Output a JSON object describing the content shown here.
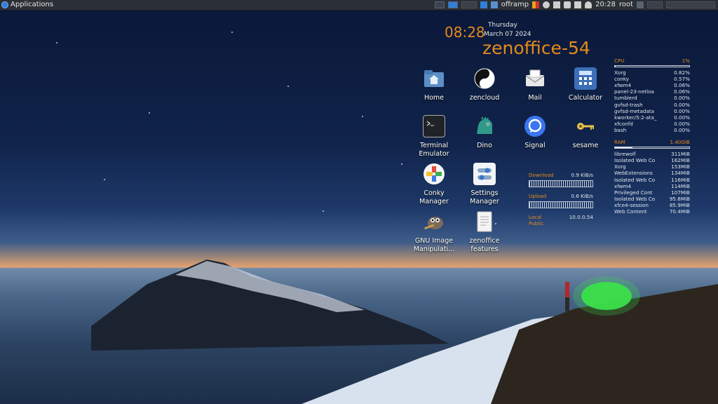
{
  "panel": {
    "apps_label": "Applications",
    "tray_app_label": "offramp",
    "time": "20:28",
    "user": "root"
  },
  "clock": {
    "time": "08:28",
    "day": "Thursday",
    "date": "March 07 2024",
    "hostname": "zenoffice-54"
  },
  "desktop_icons": [
    {
      "label": "Home",
      "icon": "folder-home-icon"
    },
    {
      "label": "zencloud",
      "icon": "yin-yang-icon"
    },
    {
      "label": "Mail",
      "icon": "mail-icon"
    },
    {
      "label": "Calculator",
      "icon": "calculator-icon"
    },
    {
      "label": "Terminal Emulator",
      "icon": "terminal-icon"
    },
    {
      "label": "Dino",
      "icon": "dino-icon"
    },
    {
      "label": "Signal",
      "icon": "signal-icon"
    },
    {
      "label": "sesame",
      "icon": "key-icon"
    },
    {
      "label": "Conky Manager",
      "icon": "conky-icon"
    },
    {
      "label": "Settings Manager",
      "icon": "settings-icon"
    },
    {
      "label": "GNU Image Manipulati...",
      "icon": "gimp-icon"
    },
    {
      "label": "zenoffice features",
      "icon": "document-icon"
    }
  ],
  "cpu": {
    "label": "CPU",
    "value": "1%",
    "usage_fraction": 0.01,
    "processes": [
      {
        "name": "Xorg",
        "value": "0.82%"
      },
      {
        "name": "conky",
        "value": "0.57%"
      },
      {
        "name": "xfwm4",
        "value": "0.06%"
      },
      {
        "name": "panel-23-netloa",
        "value": "0.06%"
      },
      {
        "name": "tumblerd",
        "value": "0.00%"
      },
      {
        "name": "gvfsd-trash",
        "value": "0.00%"
      },
      {
        "name": "gvfsd-metadata",
        "value": "0.00%"
      },
      {
        "name": "kworker/5:2-ata_",
        "value": "0.00%"
      },
      {
        "name": "xfconfd",
        "value": "0.00%"
      },
      {
        "name": "bash",
        "value": "0.00%"
      }
    ]
  },
  "ram": {
    "label": "RAM",
    "value": "1.40GiB",
    "usage_fraction": 0.24,
    "processes": [
      {
        "name": "librewolf",
        "value": "311MiB"
      },
      {
        "name": "Isolated Web Co",
        "value": "162MiB"
      },
      {
        "name": "Xorg",
        "value": "153MiB"
      },
      {
        "name": "WebExtensions",
        "value": "134MiB"
      },
      {
        "name": "Isolated Web Co",
        "value": "116MiB"
      },
      {
        "name": "xfwm4",
        "value": "114MiB"
      },
      {
        "name": "Privileged Cont",
        "value": "107MiB"
      },
      {
        "name": "Isolated Web Co",
        "value": "95.8MiB"
      },
      {
        "name": "xfce4-session",
        "value": "85.9MiB"
      },
      {
        "name": "Web Content",
        "value": "70.4MiB"
      }
    ]
  },
  "network": {
    "download_label": "Download",
    "download_value": "0.9 KiB/s",
    "upload_label": "Upload",
    "upload_value": "0.6 KiB/s",
    "local_label": "Local",
    "public_label": "Public",
    "local_ip": "10.0.0.54"
  },
  "colors": {
    "accent": "#e58a1c",
    "panel_bg": "#2b2f36"
  }
}
